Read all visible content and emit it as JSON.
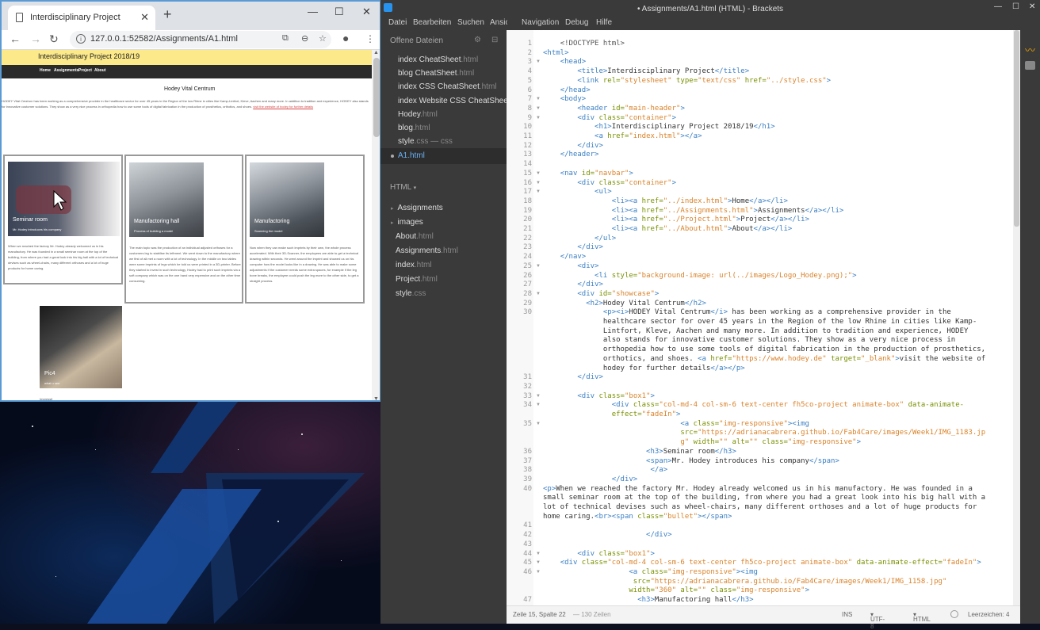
{
  "browser": {
    "tab_title": "Interdisciplinary Project",
    "url": "127.0.0.1:52582/Assignments/A1.html",
    "page": {
      "header_title": "Interdisciplinary Project 2018/19",
      "nav": [
        "Home",
        "Assignments",
        "Project",
        "About"
      ],
      "showcase_title": "Hodey Vital Centrum",
      "intro_italic": "HODEY Vital Centrum",
      "intro_text": " has been working as a comprehensive provider in the healthcare sector for over 45 years in the Region of the low Rhine in cities like Kamp-Lintfort, Kleve, Aachen and many more. In addition to tradition and experience, HODEY also stands for innovative customer solutions. They show as a very nice process in orthopedia how to use some tools of digital fabrication in the production of prosthetics, orthotics, and shoes.",
      "intro_link": "visit the website of hodey for further details",
      "boxes": [
        {
          "title": "Seminar room",
          "subtitle": "Mr. Hodey introduces his company",
          "text": "When we reached the factory Mr. Hodey already welcomed us in his manufactory. He was founded in a small seminar room at the top of the building, from where you had a great look into his big hall with a lot of technical devises such as wheel-chairs, many different orthoses and a lot of huge products for home caring."
        },
        {
          "title": "Manufactoring hall",
          "subtitle": "Process of building a model",
          "text": "The main topic was the production of an individual adjusted orthoses for a customers leg to stabilise its leftment. We went down to the manufactory where we first of all met a room with a lot of technology. In the middle on two tables were some imprints of legs which he told us were printed in a 3D-printer. Before they started to invest in such technology, Hodey had to print such imprints via a soft company which was on the one hand very expensive and on the other time consuming."
        },
        {
          "title": "Manufactoring",
          "subtitle": "Scanning the model",
          "text": "Now when they can make such imprints by their own, the whole process accelerated. With their 3D-Scanner, the employees are able to get a technical drawing within seconds. He went around the imprint and showed us on his computer how the model looks like in a drawing. He was able to make some adjustments if the customer needs some extra spaces, for example if the leg bone breaks, the employee could push the leg more to the other side, to get a straight process."
        },
        {
          "title": "Pic4",
          "subtitle": "what u see"
        }
      ],
      "footer_text": "Impressit"
    }
  },
  "brackets": {
    "window_title": "• Assignments/A1.html (HTML) - Brackets",
    "menu": [
      "Datei",
      "Bearbeiten",
      "Suchen",
      "Ansicht",
      "Navigation",
      "Debug",
      "Hilfe"
    ],
    "open_files_label": "Offene Dateien",
    "open_files": [
      {
        "name": "index CheatSheet",
        "ext": ".html"
      },
      {
        "name": "blog CheatSheet",
        "ext": ".html"
      },
      {
        "name": "index CSS CheatSheet",
        "ext": ".html"
      },
      {
        "name": "index Website CSS CheatSheet",
        "ext": ""
      },
      {
        "name": "Hodey",
        "ext": ".html"
      },
      {
        "name": "blog",
        "ext": ".html"
      },
      {
        "name": "style",
        "ext": ".css — css"
      },
      {
        "name": "A1",
        "ext": ".html"
      }
    ],
    "project_label": "HTML",
    "folders": [
      "Assignments",
      "images"
    ],
    "project_files": [
      {
        "name": "About",
        "ext": ".html"
      },
      {
        "name": "Assignments",
        "ext": ".html"
      },
      {
        "name": "index",
        "ext": ".html"
      },
      {
        "name": "Project",
        "ext": ".html"
      },
      {
        "name": "style",
        "ext": ".css"
      }
    ],
    "status": {
      "position": "Zeile 15, Spalte 22",
      "lines": "— 130 Zeilen",
      "mode": "INS",
      "encoding": "UTF-8",
      "language": "HTML",
      "indent": "Leerzeichen: 4"
    }
  }
}
